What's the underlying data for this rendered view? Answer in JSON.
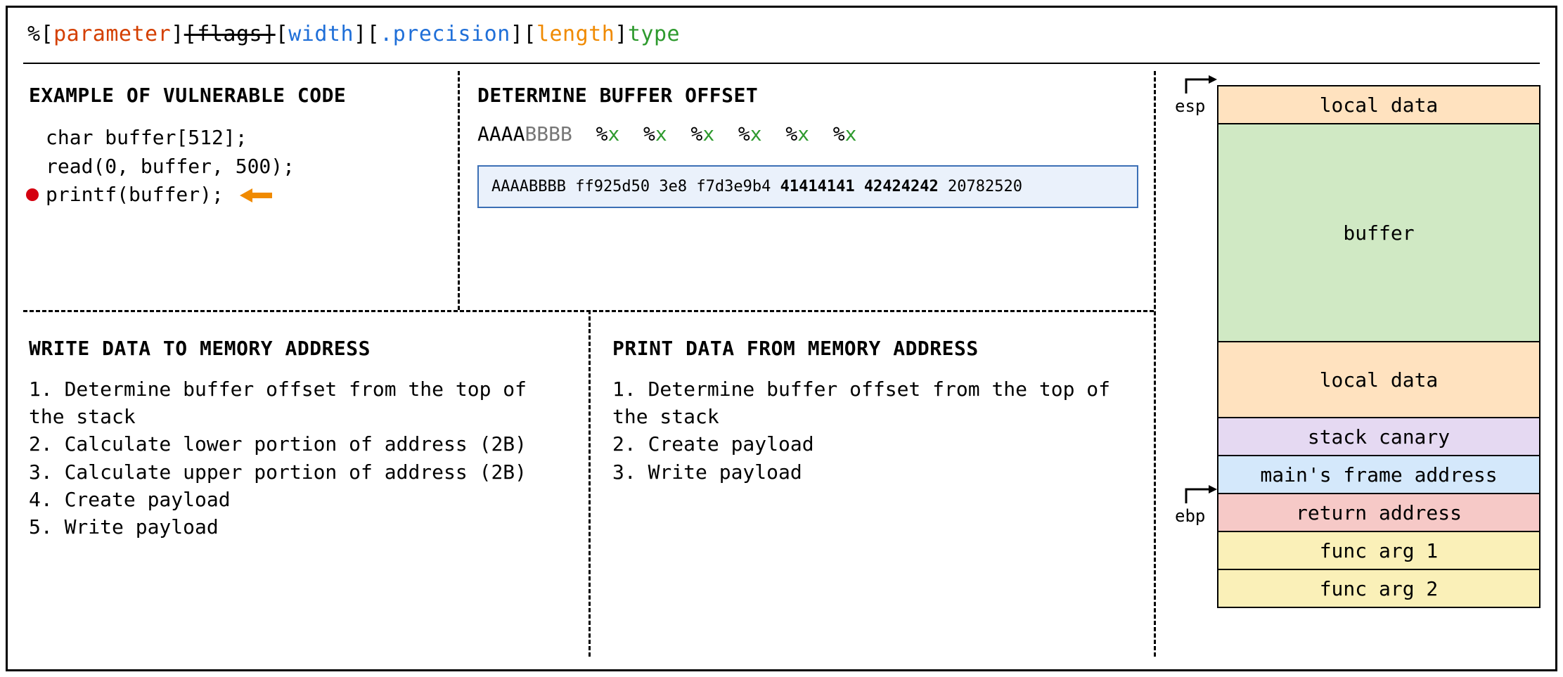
{
  "format_string": {
    "percent": "%",
    "parameter": "parameter",
    "flags": "[flags]",
    "width": "width",
    "precision": ".precision",
    "length": "length",
    "type": "type"
  },
  "example": {
    "title": "EXAMPLE OF VULNERABLE CODE",
    "line1": "char buffer[512];",
    "line2": "read(0, buffer, 500);",
    "line3": "printf(buffer);"
  },
  "offset": {
    "title": "DETERMINE BUFFER OFFSET",
    "input_aaaa": "AAAA",
    "input_bbbb": "BBBB",
    "token1": "%",
    "tokenx": "x",
    "output_pre": "AAAABBBB ff925d50 3e8 f7d3e9b4 ",
    "output_bold": "41414141 42424242",
    "output_post": " 20782520"
  },
  "write": {
    "title": "WRITE DATA TO MEMORY ADDRESS",
    "steps": "1. Determine buffer offset from the top of the stack\n2. Calculate lower portion of address (2B)\n3. Calculate upper portion of address (2B)\n4. Create payload\n5. Write payload"
  },
  "print": {
    "title": "PRINT DATA FROM MEMORY ADDRESS",
    "steps": "1. Determine buffer offset from the top of the stack\n2. Create payload\n3. Write payload"
  },
  "stack": {
    "esp": "esp",
    "ebp": "ebp",
    "cells": {
      "local_data_top": "local data",
      "buffer": "buffer",
      "local_data_bot": "local data",
      "canary": "stack canary",
      "main_frame": "main's frame address",
      "ret": "return address",
      "arg1": "func arg 1",
      "arg2": "func arg 2"
    }
  }
}
